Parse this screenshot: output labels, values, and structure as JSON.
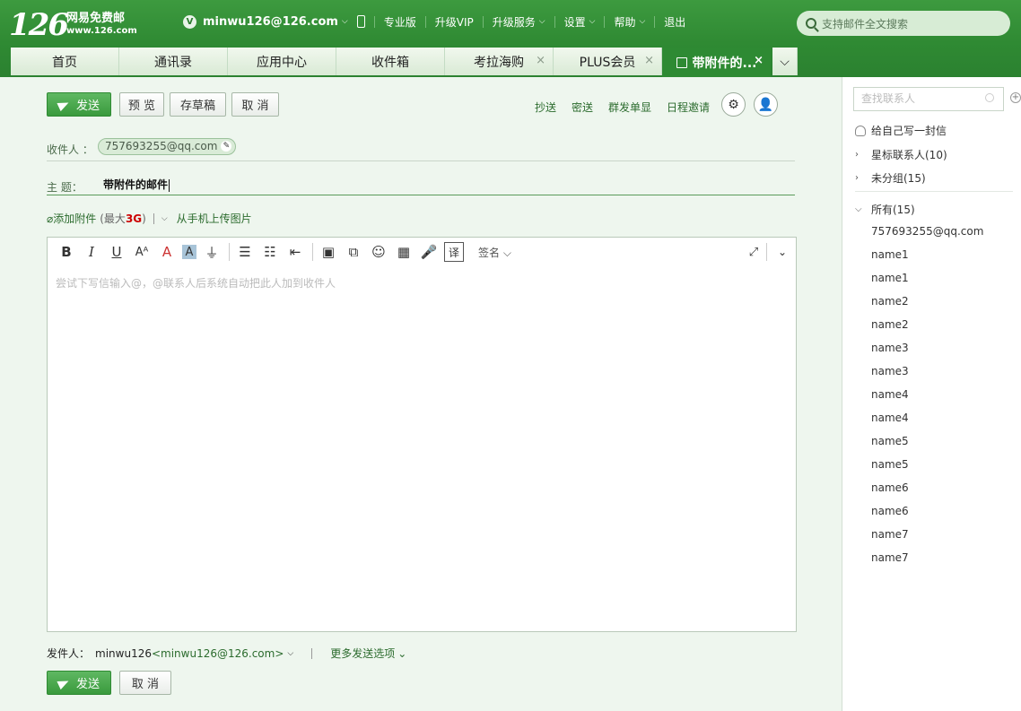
{
  "header": {
    "logo_num": "126",
    "logo_cn": "网易免费邮",
    "logo_url": "www.126.com",
    "account_badge": "V",
    "account": "minwu126@126.com",
    "nav": [
      "专业版",
      "升级VIP",
      "升级服务",
      "设置",
      "帮助",
      "退出"
    ],
    "search_placeholder": "支持邮件全文搜索"
  },
  "tabs": [
    {
      "label": "首页"
    },
    {
      "label": "通讯录"
    },
    {
      "label": "应用中心"
    },
    {
      "label": "收件箱"
    },
    {
      "label": "考拉海购",
      "close": "×"
    },
    {
      "label": "PLUS会员",
      "close": "×"
    },
    {
      "label": "带附件的...",
      "close": "×"
    }
  ],
  "compose": {
    "send_label": "发送",
    "preview_label": "预 览",
    "draft_label": "存草稿",
    "cancel_label": "取 消",
    "cc_label": "抄送",
    "bcc_label": "密送",
    "mass_label": "群发单显",
    "schedule_label": "日程邀请",
    "to_label": "收件人 ：",
    "recipient": "757693255@qq.com",
    "subject_label": "主  题：",
    "subject_value": "带附件的邮件",
    "attach_label": "添加附件",
    "attach_max_prefix": "(最大",
    "attach_max_value": "3G",
    "attach_max_suffix": ")",
    "mobile_upload": "从手机上传图片",
    "signature_label": "签名",
    "body_placeholder": "尝试下写信输入@，@联系人后系统自动把此人加到收件人",
    "sender_label": "发件人：",
    "sender_name": "minwu126",
    "sender_addr": "<minwu126@126.com>",
    "more_options": "更多发送选项"
  },
  "sidebar": {
    "search_placeholder": "查找联系人",
    "self_mail": "给自己写一封信",
    "starred": "星标联系人(10)",
    "ungrouped": "未分组(15)",
    "all": "所有(15)",
    "contacts": [
      "757693255@qq.com",
      "name1",
      "name1",
      "name2",
      "name2",
      "name3",
      "name3",
      "name4",
      "name4",
      "name5",
      "name5",
      "name6",
      "name6",
      "name7",
      "name7"
    ]
  }
}
